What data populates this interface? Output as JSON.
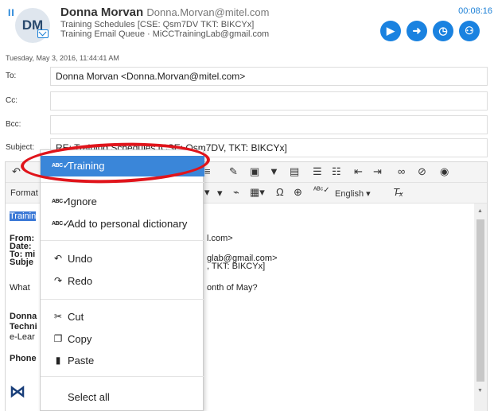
{
  "header": {
    "pause_icon": "pause-icon",
    "avatar_initials": "DM",
    "name": "Donna Morvan",
    "email": "Donna.Morvan@mitel.com",
    "line2": "Training Schedules [CSE: Qsm7DV TKT: BIKCYx]",
    "line3": "Training Email Queue · MiCCTrainingLab@gmail.com",
    "timer": "00:08:16",
    "actions": [
      "play-icon",
      "forward-icon",
      "clock-icon",
      "users-icon"
    ]
  },
  "date": "Tuesday, May 3, 2016, 11:44:41 AM",
  "fields": {
    "to_label": "To:",
    "to_value": "Donna Morvan <Donna.Morvan@mitel.com>",
    "cc_label": "Cc:",
    "cc_value": "",
    "bcc_label": "Bcc:",
    "bcc_value": "",
    "subject_label": "Subject:",
    "subject_value": "RE: Training Schedules [CSE: Qsm7DV, TKT: BIKCYx]"
  },
  "toolbar": {
    "format_label": "Format",
    "language_label": "English"
  },
  "body": {
    "selected_word": "Trainin",
    "from_label": "From:",
    "from_tail": "l.com>",
    "date_label": "Date:",
    "to_label": "To: mi",
    "to_tail": "glab@gmail.com>",
    "subject_label": "Subje",
    "subject_tail": ", TKT: BIKCYx]",
    "what": "What",
    "what_tail": "onth of May?",
    "sig1": "Donna",
    "sig2": "Techni",
    "sig3": "e-Lear",
    "phone": "Phone"
  },
  "context_menu": {
    "suggestion": "Training",
    "ignore": "Ignore",
    "add_dictionary": "Add to personal dictionary",
    "undo": "Undo",
    "redo": "Redo",
    "cut": "Cut",
    "copy": "Copy",
    "paste": "Paste",
    "select_all": "Select all"
  },
  "colors": {
    "accent": "#1a82e0",
    "selection": "#3a86d9",
    "annotation_ring": "#e0141b"
  }
}
